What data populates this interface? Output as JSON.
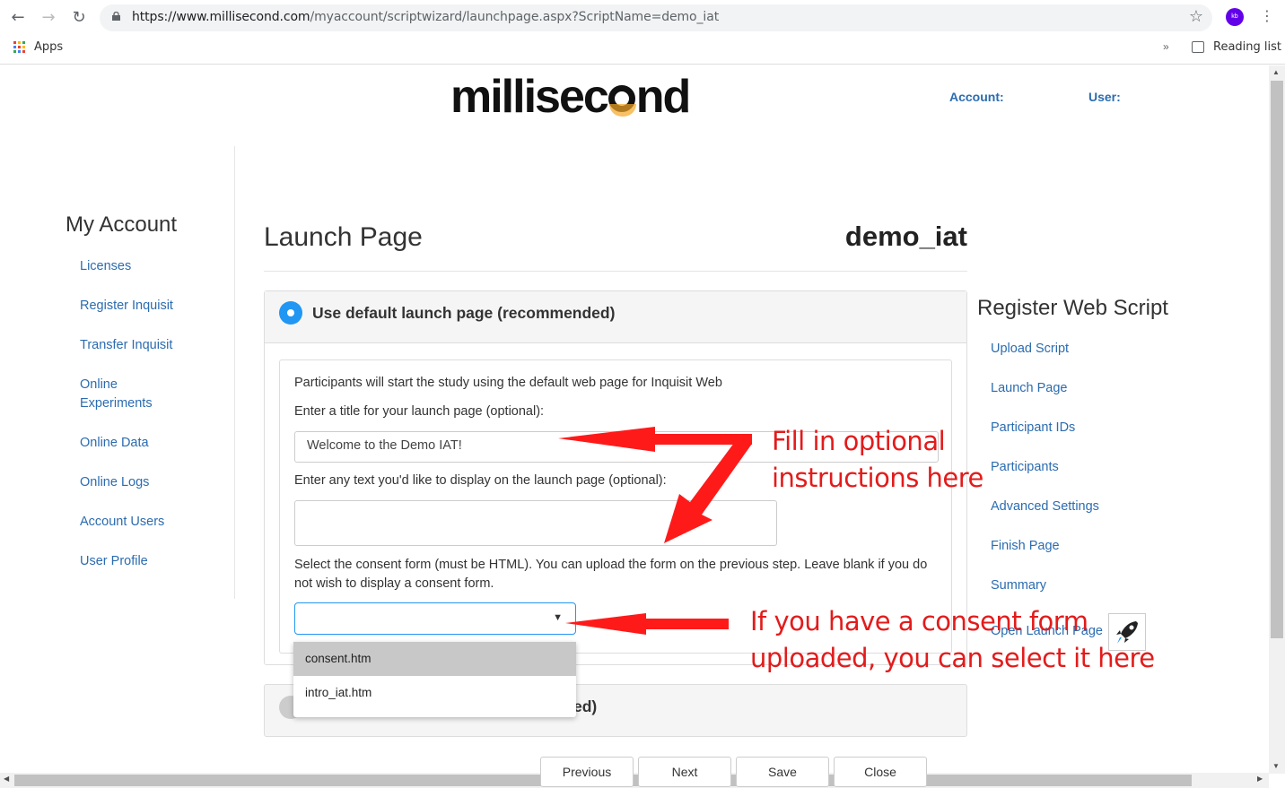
{
  "browser": {
    "url_host": "https://www.millisecond.com",
    "url_path": "/myaccount/scriptwizard/launchpage.aspx?ScriptName=demo_iat",
    "profile_initials": "kb",
    "bookmarks": {
      "apps_label": "Apps",
      "reading_list_label": "Reading list",
      "overflow": "»"
    }
  },
  "header": {
    "logo_text_a": "millisec",
    "logo_text_b": "nd",
    "account_label": "Account:",
    "user_label": "User:"
  },
  "sidebar": {
    "title": "My Account",
    "items": [
      {
        "label": "Licenses"
      },
      {
        "label": "Register Inquisit"
      },
      {
        "label": "Transfer Inquisit"
      },
      {
        "label": "Online Experiments"
      },
      {
        "label": "Online Data"
      },
      {
        "label": "Online Logs"
      },
      {
        "label": "Account Users"
      },
      {
        "label": "User Profile"
      }
    ]
  },
  "main": {
    "page_title": "Launch Page",
    "script_name": "demo_iat",
    "default_option": {
      "label": "Use default launch page (recommended)",
      "selected": true,
      "intro_text": "Participants will start the study using the default web page for Inquisit Web",
      "title_prompt": "Enter a title for your launch page (optional):",
      "title_value": "Welcome to the Demo IAT!",
      "text_prompt": "Enter any text you'd like to display on the launch page (optional):",
      "text_value": "",
      "consent_prompt_line1": "Select the consent form (must be HTML). You can upload the form on the previous step. Leave blank if you do",
      "consent_prompt_line2": "not wish to display a consent form.",
      "consent_selected": "",
      "consent_options": [
        "consent.htm",
        "intro_iat.htm"
      ]
    },
    "custom_option": {
      "label_visible_fragment": "ed)",
      "selected": false
    },
    "buttons": {
      "previous": "Previous",
      "next": "Next",
      "save": "Save",
      "close": "Close"
    }
  },
  "right_sidebar": {
    "title": "Register Web Script",
    "items": [
      {
        "label": "Upload Script"
      },
      {
        "label": "Launch Page"
      },
      {
        "label": "Participant IDs"
      },
      {
        "label": "Participants"
      },
      {
        "label": "Advanced Settings"
      },
      {
        "label": "Finish Page"
      },
      {
        "label": "Summary"
      },
      {
        "label": "Open Launch Page"
      }
    ]
  },
  "annotations": {
    "note1_line1": "Fill in optional",
    "note1_line2": "instructions here",
    "note2_line1": "If you have a consent form",
    "note2_line2": "uploaded, you can select it here",
    "color": "#e31b1b"
  },
  "colors": {
    "link": "#2b6cb0",
    "radio_selected": "#2196f3",
    "option_highlight": "#c8c8c8"
  }
}
